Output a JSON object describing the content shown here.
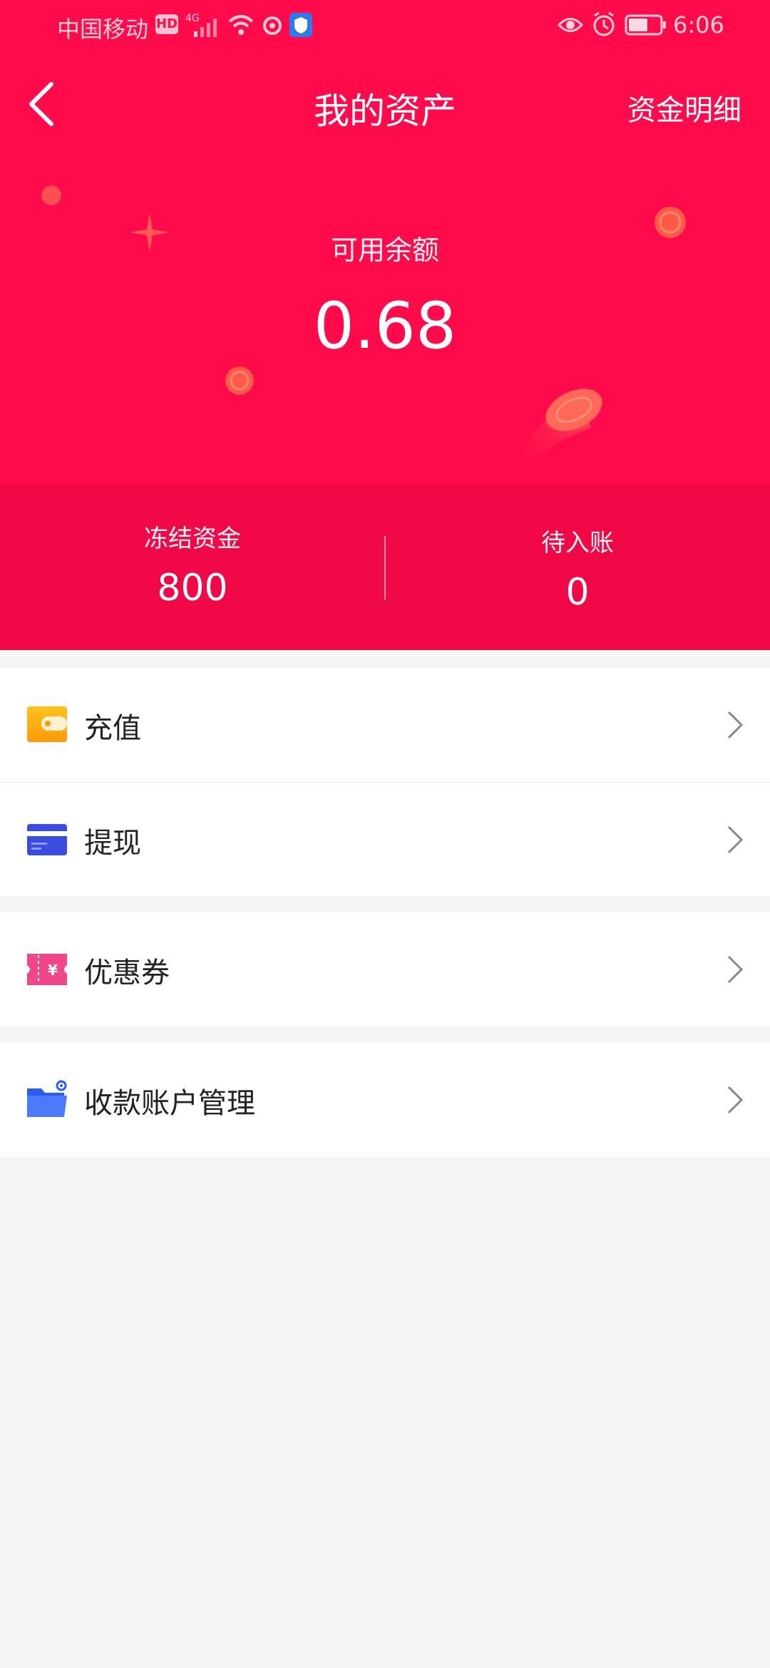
{
  "status_bar": {
    "carrier": "中国移动",
    "hd": "HD",
    "network": "4G",
    "time": "6:06"
  },
  "header": {
    "title": "我的资产",
    "detail_link": "资金明细"
  },
  "balance": {
    "label": "可用余额",
    "value": "0.68"
  },
  "stats": {
    "frozen": {
      "label": "冻结资金",
      "value": "800"
    },
    "pending": {
      "label": "待入账",
      "value": "0"
    }
  },
  "menu": {
    "recharge": {
      "label": "充值",
      "icon": "wallet-icon"
    },
    "withdraw": {
      "label": "提现",
      "icon": "bank-card-icon"
    },
    "coupon": {
      "label": "优惠券",
      "icon": "coupon-icon"
    },
    "account": {
      "label": "收款账户管理",
      "icon": "folder-settings-icon"
    }
  },
  "colors": {
    "primary": "#ff0a4a",
    "primary_dark": "#f00847",
    "background": "#f5f5f5"
  }
}
